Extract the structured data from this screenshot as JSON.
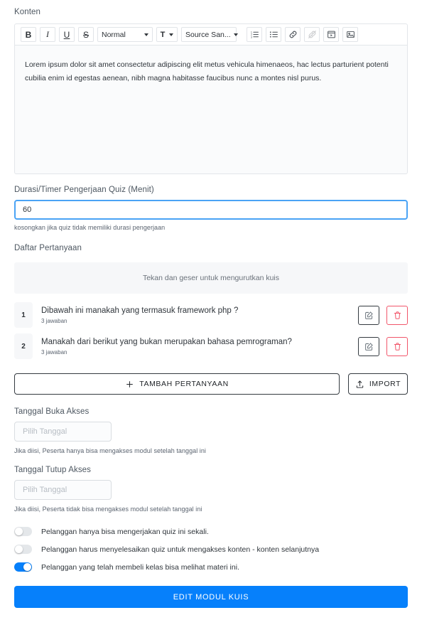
{
  "content_section": {
    "label": "Konten",
    "toolbar": {
      "bold": "B",
      "italic": "I",
      "underline": "U",
      "strike": "S",
      "block_format": "Normal",
      "size_icon": "T",
      "font_family": "Source San...",
      "icons": {
        "ordered_list": "ordered-list-icon",
        "bullet_list": "bullet-list-icon",
        "link": "link-icon",
        "unlink": "unlink-icon",
        "video": "video-embed-icon",
        "image": "image-icon"
      }
    },
    "body_text": "Lorem ipsum dolor sit amet consectetur adipiscing elit metus vehicula himenaeos, hac lectus parturient potenti cubilia enim id egestas aenean, nibh magna habitasse faucibus nunc a montes nisl purus."
  },
  "duration": {
    "label": "Durasi/Timer Pengerjaan Quiz (Menit)",
    "value": "60",
    "placeholder": "",
    "helper": "kosongkan jika quiz tidak memiliki durasi pengerjaan"
  },
  "questions_section": {
    "label": "Daftar Pertanyaan",
    "sort_hint": "Tekan dan geser untuk mengurutkan kuis",
    "items": [
      {
        "number": "1",
        "title": "Dibawah ini manakah yang termasuk framework php ?",
        "answers": "3 jawaban"
      },
      {
        "number": "2",
        "title": "Manakah dari berikut yang bukan merupakan bahasa pemrograman?",
        "answers": "3 jawaban"
      }
    ],
    "add_button": "TAMBAH PERTANYAAN",
    "import_button": "IMPORT"
  },
  "open_date": {
    "label": "Tanggal Buka Akses",
    "placeholder": "Pilih Tanggal",
    "helper": "Jika diisi, Peserta hanya bisa mengakses modul setelah tanggal ini"
  },
  "close_date": {
    "label": "Tanggal Tutup Akses",
    "placeholder": "Pilih Tanggal",
    "helper": "Jika diisi, Peserta tidak bisa mengakses modul setelah tanggal ini"
  },
  "toggles": [
    {
      "label": "Pelanggan hanya bisa mengerjakan quiz ini sekali.",
      "on": false
    },
    {
      "label": "Pelanggan harus menyelesaikan quiz untuk mengakses konten - konten selanjutnya",
      "on": false
    },
    {
      "label": "Pelanggan yang telah membeli kelas bisa melihat materi ini.",
      "on": true
    }
  ],
  "submit_button": "EDIT MODUL KUIS",
  "colors": {
    "accent": "#0680fb",
    "danger": "#f1566a",
    "border": "#e3e6ea",
    "muted_bg": "#f6f7f9"
  }
}
